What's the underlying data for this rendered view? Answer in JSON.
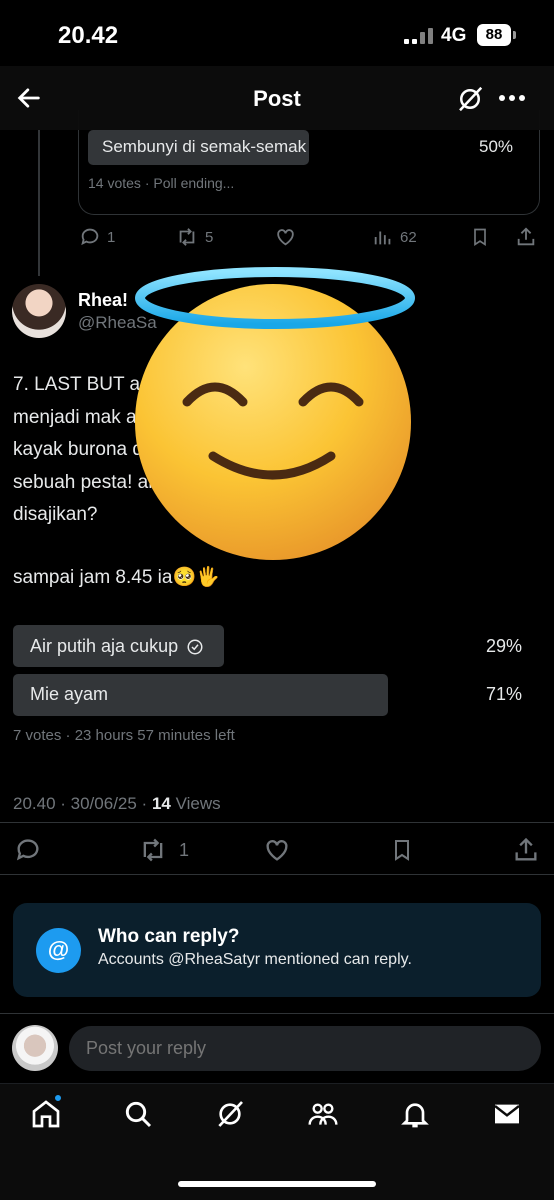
{
  "status": {
    "time": "20.42",
    "network": "4G",
    "battery": "88"
  },
  "header": {
    "title": "Post"
  },
  "previous_post": {
    "poll_option": "Sembunyi di semak-semak",
    "poll_percent": "50%",
    "poll_meta": "14 votes · Poll ending...",
    "reply_count": "1",
    "repost_count": "5",
    "view_count": "62"
  },
  "post": {
    "author_name": "Rhea!",
    "author_handle": "@RheaSa",
    "text_line1": "7. LAST BUT                                           a sudah\nmenjadi mak                                          ak dikejar\nkayak burona                                         dakan\nsebuah pesta!                                        ang akan\ndisajikan?",
    "text_line2": "sampai jam 8.45 ia🥺🖐",
    "poll": {
      "options": [
        {
          "label": "Air putih aja cukup",
          "percent": "29%",
          "fraction": 0.29,
          "voted": true
        },
        {
          "label": "Mie ayam",
          "percent": "71%",
          "fraction": 0.71,
          "voted": false
        }
      ],
      "meta": "7 votes · 23 hours 57 minutes left"
    },
    "timestamp": "20.40 · 30/06/25 · ",
    "views_count": "14",
    "views_label": " Views",
    "repost_count": "1"
  },
  "who_can_reply": {
    "title": "Who can reply?",
    "subtitle": "Accounts @RheaSatyr mentioned can reply."
  },
  "composer": {
    "placeholder": "Post your reply"
  },
  "colors": {
    "accent": "#1d9bf0",
    "bar": "#333639",
    "muted": "#71767b"
  },
  "icons": [
    "back-arrow-icon",
    "grok-icon",
    "more-icon",
    "reply-icon",
    "repost-icon",
    "like-icon",
    "views-icon",
    "bookmark-icon",
    "share-icon",
    "home-icon",
    "search-icon",
    "grok-tab-icon",
    "communities-icon",
    "notifications-icon",
    "messages-icon",
    "halo-smiling-emoji"
  ]
}
